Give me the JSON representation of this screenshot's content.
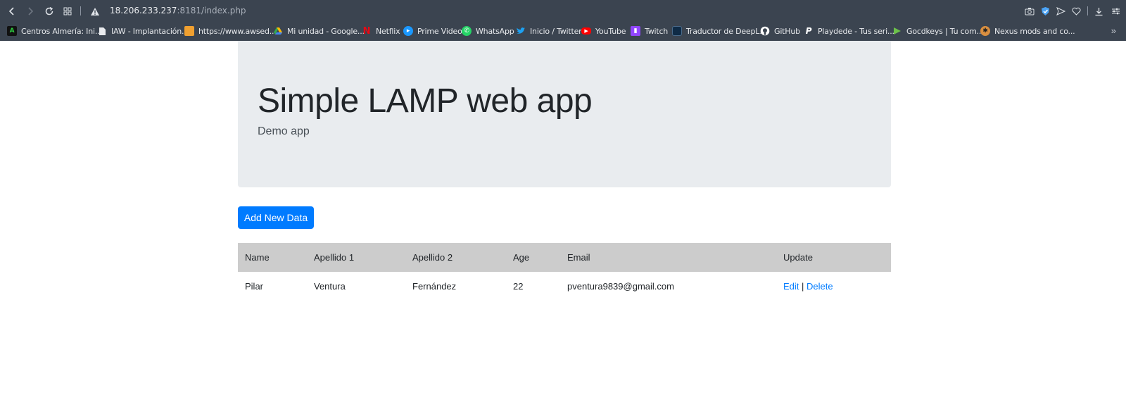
{
  "browser": {
    "url_host": "18.206.233.237",
    "url_rest": ":8181/index.php",
    "bookmarks": [
      {
        "label": "Centros Almería: Ini...",
        "icon": "a-logo-icon",
        "color": "#111111"
      },
      {
        "label": "IAW - Implantación...",
        "icon": "page-icon",
        "color": "#e8eaed"
      },
      {
        "label": "https://www.awsed...",
        "icon": "package-icon",
        "color": "#f0a030"
      },
      {
        "label": "Mi unidad - Google...",
        "icon": "google-drive-icon",
        "color": "#34a853"
      },
      {
        "label": "Netflix",
        "icon": "netflix-icon",
        "color": "#e50914"
      },
      {
        "label": "Prime Video",
        "icon": "prime-video-icon",
        "color": "#1a98ff"
      },
      {
        "label": "WhatsApp",
        "icon": "whatsapp-icon",
        "color": "#25d366"
      },
      {
        "label": "Inicio / Twitter",
        "icon": "twitter-icon",
        "color": "#1da1f2"
      },
      {
        "label": "YouTube",
        "icon": "youtube-icon",
        "color": "#ff0000"
      },
      {
        "label": "Twitch",
        "icon": "twitch-icon",
        "color": "#9146ff"
      },
      {
        "label": "Traductor de DeepL...",
        "icon": "deepl-icon",
        "color": "#0f2b46"
      },
      {
        "label": "GitHub",
        "icon": "github-icon",
        "color": "#ffffff"
      },
      {
        "label": "Playdede - Tus seri...",
        "icon": "playdede-icon",
        "color": "#ffffff"
      },
      {
        "label": "Gocdkeys | Tu com...",
        "icon": "gocdkeys-icon",
        "color": "#6cc24a"
      },
      {
        "label": "Nexus mods and co...",
        "icon": "nexus-mods-icon",
        "color": "#d98f40"
      }
    ]
  },
  "page": {
    "title": "Simple LAMP web app",
    "subtitle": "Demo app",
    "add_button": "Add New Data",
    "table": {
      "headers": [
        "Name",
        "Apellido 1",
        "Apellido 2",
        "Age",
        "Email",
        "Update"
      ],
      "rows": [
        {
          "name": "Pilar",
          "apellido1": "Ventura",
          "apellido2": "Fernández",
          "age": "22",
          "email": "pventura9839@gmail.com",
          "edit": "Edit",
          "sep": "|",
          "delete": "Delete"
        }
      ]
    }
  },
  "colors": {
    "accent": "#007bff",
    "jumbotron": "#e9ecef",
    "table_header": "#cccccc",
    "chrome": "#3b4450"
  }
}
